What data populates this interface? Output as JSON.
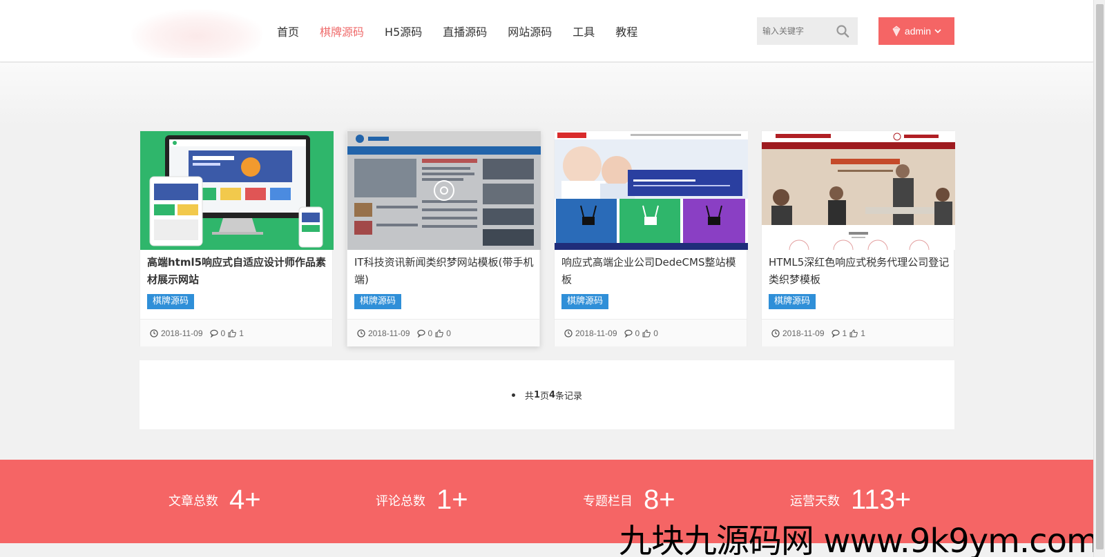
{
  "nav": {
    "items": [
      {
        "label": "首页",
        "active": false
      },
      {
        "label": "棋牌源码",
        "active": true
      },
      {
        "label": "H5源码",
        "active": false
      },
      {
        "label": "直播源码",
        "active": false
      },
      {
        "label": "网站源码",
        "active": false
      },
      {
        "label": "工具",
        "active": false
      },
      {
        "label": "教程",
        "active": false
      }
    ]
  },
  "search": {
    "placeholder": "输入关键字",
    "icon": "search-icon"
  },
  "user": {
    "label": "admin",
    "icon": "gem-icon"
  },
  "cards": [
    {
      "title": "高端html5响应式自适应设计师作品素材展示网站",
      "tag": "棋牌源码",
      "date": "2018-11-09",
      "comments": "0",
      "likes": "1"
    },
    {
      "title": "IT科技资讯新闻类织梦网站模板(带手机端)",
      "tag": "棋牌源码",
      "date": "2018-11-09",
      "comments": "0",
      "likes": "0"
    },
    {
      "title": "响应式高端企业公司DedeCMS整站模板",
      "tag": "棋牌源码",
      "date": "2018-11-09",
      "comments": "0",
      "likes": "0"
    },
    {
      "title": "HTML5深红色响应式税务代理公司登记类织梦模板",
      "tag": "棋牌源码",
      "date": "2018-11-09",
      "comments": "1",
      "likes": "1"
    }
  ],
  "pager": {
    "prefix": "共",
    "pages": "1",
    "mid": "页",
    "records": "4",
    "suffix": "条记录"
  },
  "stats": [
    {
      "label": "文章总数",
      "value": "4+"
    },
    {
      "label": "评论总数",
      "value": "1+"
    },
    {
      "label": "专题栏目",
      "value": "8+"
    },
    {
      "label": "运营天数",
      "value": "113+"
    }
  ],
  "watermark": "九块九源码网 www.9k9ym.com",
  "colors": {
    "accent": "#f56565",
    "tag": "#2f8fd8",
    "active_nav": "#ef6b6b"
  }
}
